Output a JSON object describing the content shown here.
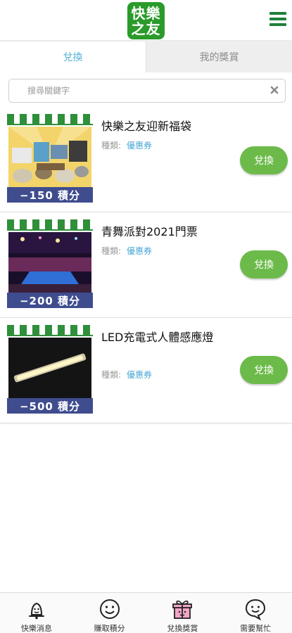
{
  "header": {
    "logo_line1": "快樂",
    "logo_line2": "之友",
    "brand_color": "#2a9a2a",
    "menu_icon": "hamburger-menu-icon"
  },
  "tabs": [
    {
      "label": "兌換",
      "active": true
    },
    {
      "label": "我的獎賞",
      "active": false
    }
  ],
  "search": {
    "placeholder": "搜尋關鍵字",
    "value": "",
    "clear_icon": "close-icon"
  },
  "items": [
    {
      "title": "快樂之友迎新福袋",
      "category_label": "種類:",
      "category_value": "優惠券",
      "points": "−150 積分",
      "button": "兌換"
    },
    {
      "title": "青舞派對2021門票",
      "category_label": "種類:",
      "category_value": "優惠券",
      "points": "−200 積分",
      "button": "兌換"
    },
    {
      "title": "LED充電式人體感應燈",
      "category_label": "種類:",
      "category_value": "優惠券",
      "points": "−500 積分",
      "button": "兌換"
    }
  ],
  "bottom_nav": [
    {
      "label": "快樂消息",
      "icon": "bell-face-icon"
    },
    {
      "label": "賺取積分",
      "icon": "smiley-face-icon"
    },
    {
      "label": "兌換獎賞",
      "icon": "gift-icon",
      "active": true
    },
    {
      "label": "需要幫忙",
      "icon": "speech-bubble-face-icon"
    }
  ],
  "colors": {
    "accent_blue": "#56b2d6",
    "button_green": "#6cbb4a",
    "points_bar": "#3f4d8f",
    "awning_green": "#2f8f3a"
  }
}
